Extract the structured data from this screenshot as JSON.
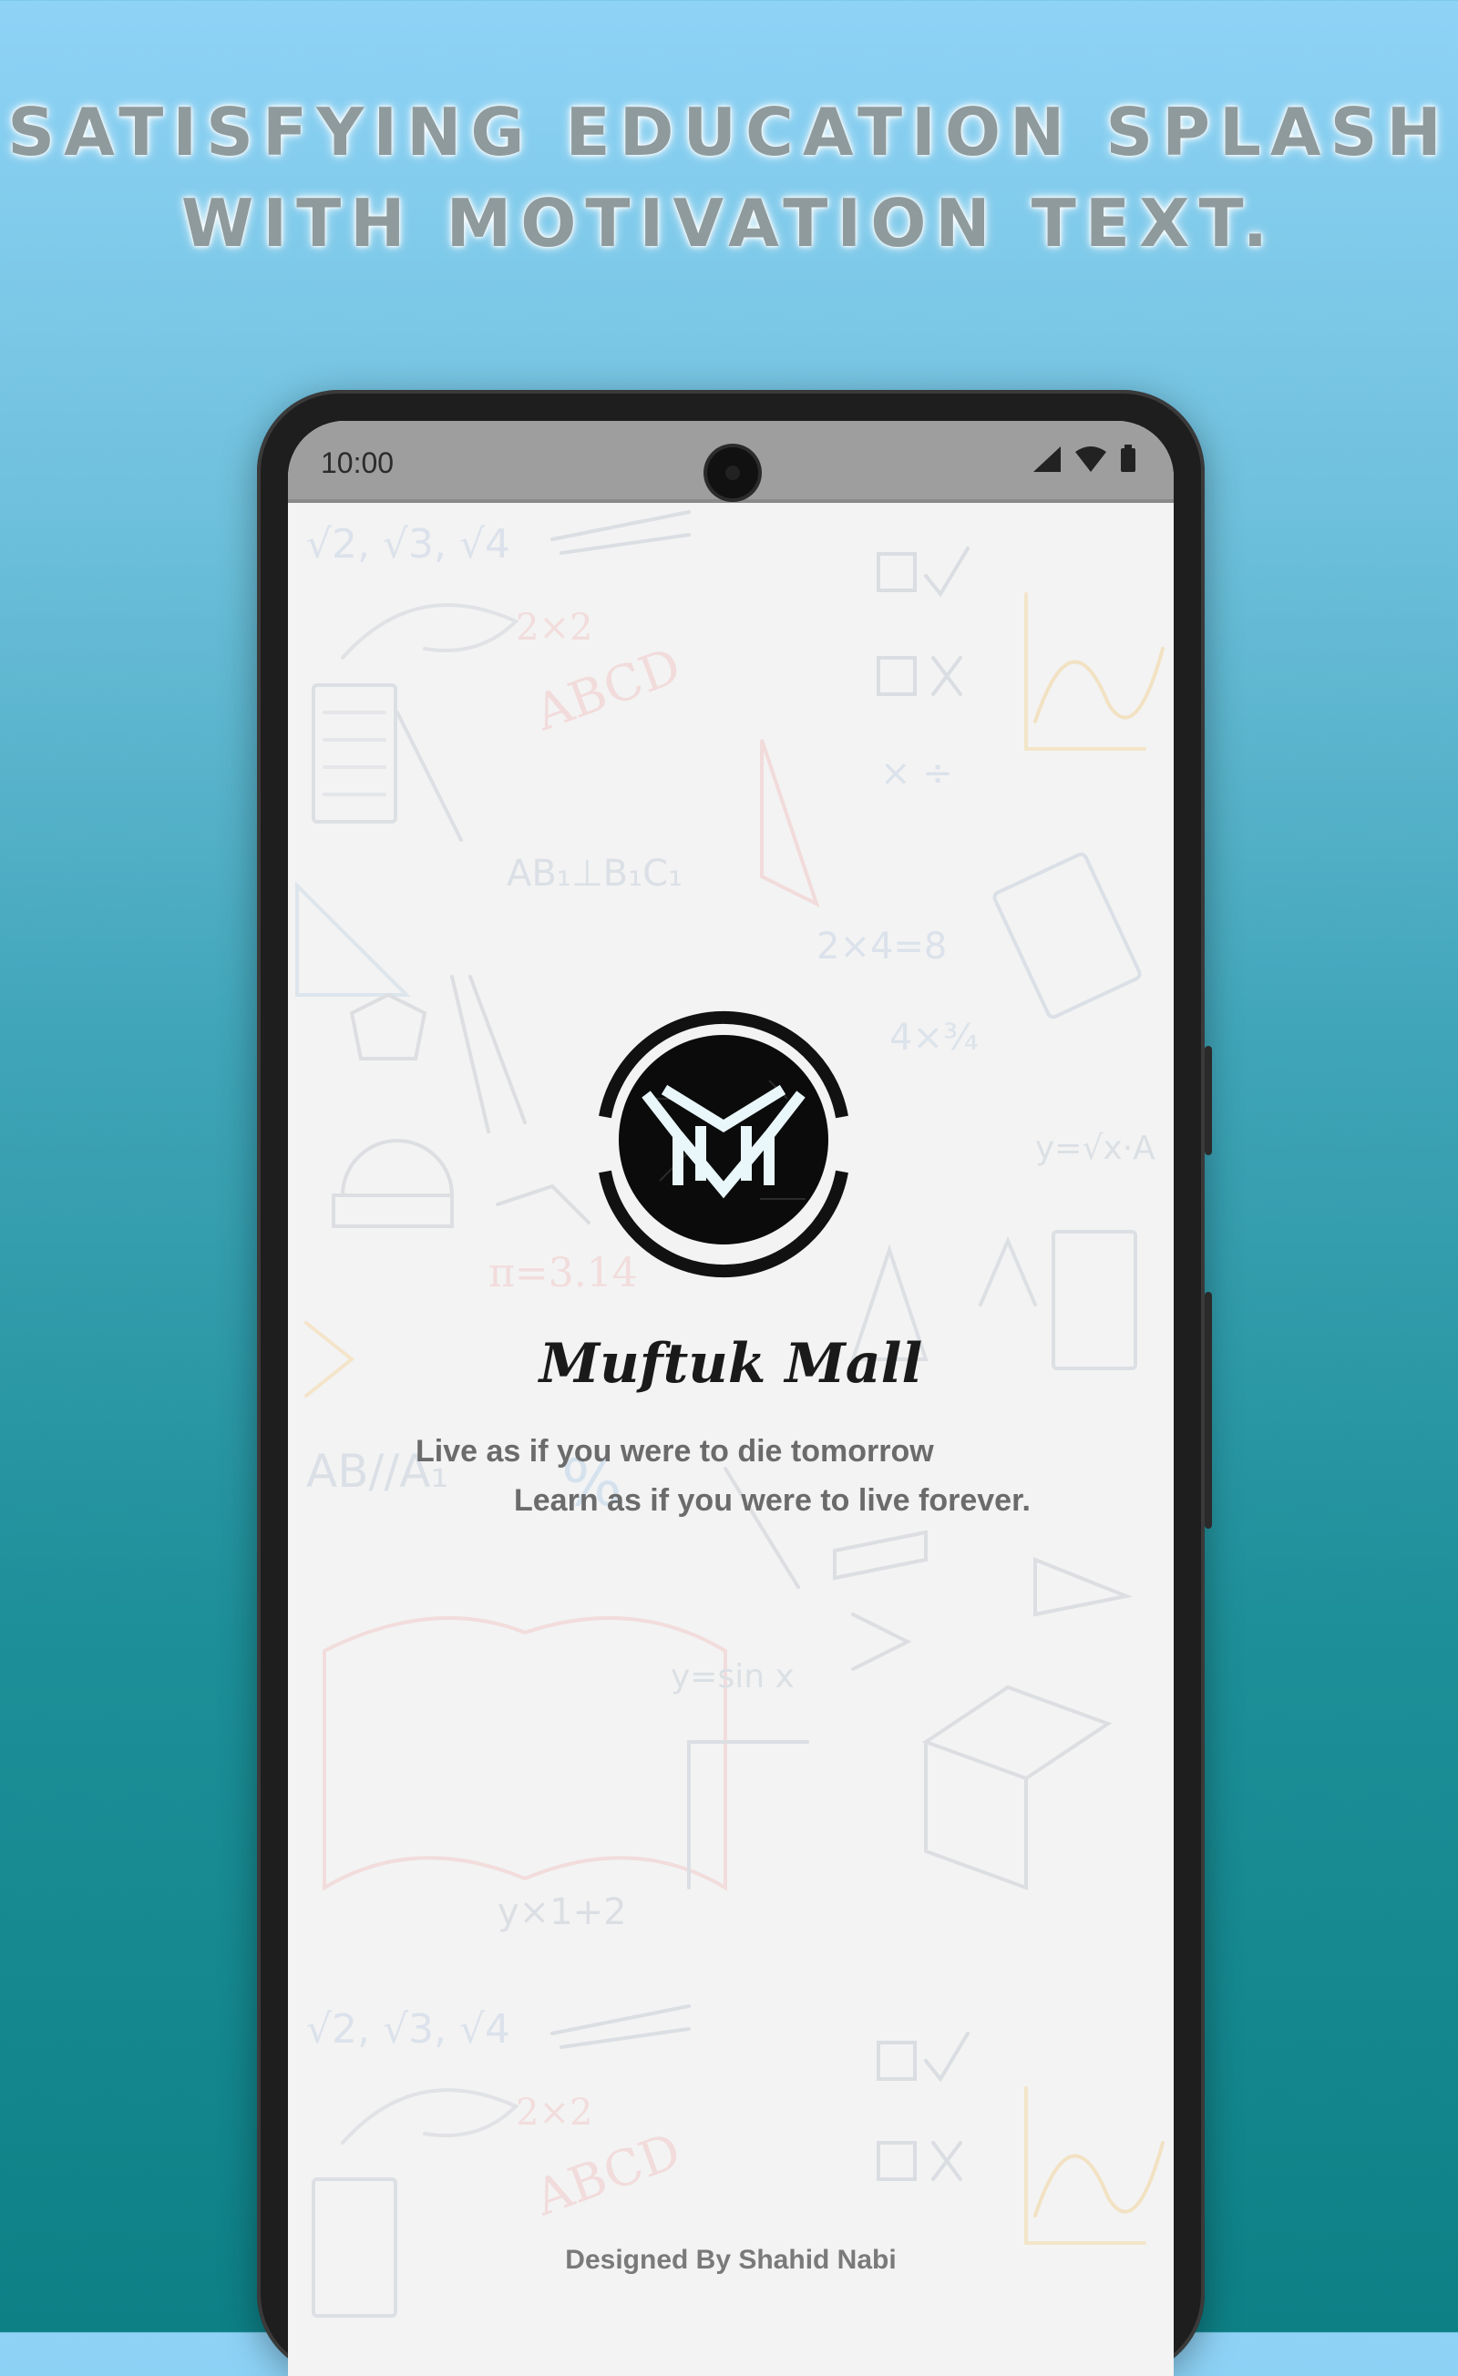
{
  "headline": {
    "line1": "Satisfying Education Splash",
    "line2": "with Motivation text."
  },
  "statusbar": {
    "time": "10:00",
    "icons": [
      "signal-icon",
      "wifi-icon",
      "battery-icon"
    ]
  },
  "app": {
    "name": "Muftuk Mall",
    "logo": "muftuk-mall-logo"
  },
  "quote": {
    "line1": "Live as if you were to die tomorrow",
    "line2": "Learn as if you were to live forever."
  },
  "footer": {
    "credit": "Designed By Shahid Nabi"
  },
  "colors": {
    "background_top": "#8fd3f7",
    "background_bottom": "#0d8086",
    "screen": "#f3f3f3",
    "statusbar": "#9e9e9e",
    "quote_text": "#6b6b6b"
  }
}
